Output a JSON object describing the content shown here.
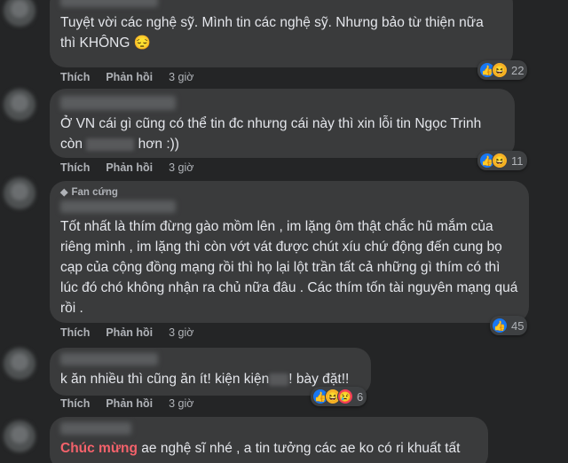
{
  "comments": [
    {
      "text": "Tuyệt vời các nghệ sỹ. Mình tin các nghệ sỹ. Nhưng bảo từ thiện nữa thì KHÔNG 😔",
      "like_label": "Thích",
      "reply_label": "Phản hồi",
      "time": "3 giờ",
      "reaction_count": "22"
    },
    {
      "text_before": "Ở VN cái gì cũng có thể tin đc nhưng cái này thì xin lỗi tin Ngọc Trinh còn ",
      "text_after": " hơn :))",
      "like_label": "Thích",
      "reply_label": "Phản hồi",
      "time": "3 giờ",
      "reaction_count": "11"
    },
    {
      "badge": "Fan cứng",
      "text": "Tốt nhất là thím đừng gào mồm lên , im lặng ôm thật chắc hũ mắm của riêng mình , im lặng thì còn vớt vát được chút xíu chứ động đến cung bọ cạp của cộng đồng mạng rồi thì họ lại lột trần tất cả những gì thím có thì lúc đó chó không nhận ra chủ nữa đâu . Các thím tốn tài nguyên mạng quá rồi .",
      "like_label": "Thích",
      "reply_label": "Phản hồi",
      "time": "3 giờ",
      "reaction_count": "45"
    },
    {
      "text_before": "k ăn nhiều thì cũng ăn ít! kiện kiện",
      "text_after": "! bày đặt!!",
      "like_label": "Thích",
      "reply_label": "Phản hồi",
      "time": "3 giờ",
      "reaction_count": "6"
    },
    {
      "highlight": "Chúc mừng",
      "text": " ae nghệ sĩ nhé , a tin tưởng các ae ko có ri khuất tất"
    }
  ],
  "colors": {
    "background": "#242526",
    "bubble": "#3a3b3c",
    "text": "#e4e6eb",
    "secondary": "#b0b3b8",
    "highlight": "#f4626b",
    "like": "#1877f2"
  }
}
